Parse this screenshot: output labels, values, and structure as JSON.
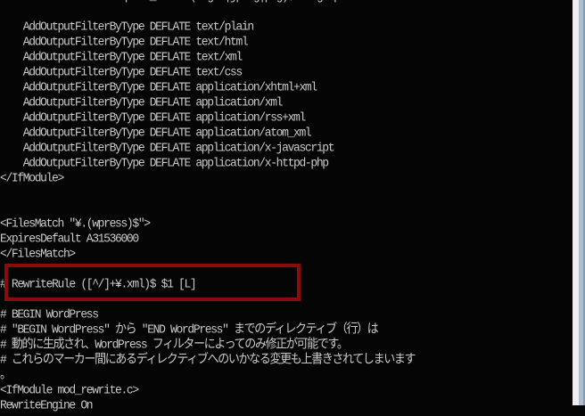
{
  "editor": {
    "lines": [
      "    SetEnvIfNoCase Request_URI ¥.(?:gif|jpe?g|png)$ no-gzip",
      "",
      "    AddOutputFilterByType DEFLATE text/plain",
      "    AddOutputFilterByType DEFLATE text/html",
      "    AddOutputFilterByType DEFLATE text/xml",
      "    AddOutputFilterByType DEFLATE text/css",
      "    AddOutputFilterByType DEFLATE application/xhtml+xml",
      "    AddOutputFilterByType DEFLATE application/xml",
      "    AddOutputFilterByType DEFLATE application/rss+xml",
      "    AddOutputFilterByType DEFLATE application/atom_xml",
      "    AddOutputFilterByType DEFLATE application/x-javascript",
      "    AddOutputFilterByType DEFLATE application/x-httpd-php",
      "</IfModule>",
      "",
      "",
      "<FilesMatch \"¥.(wpress)$\">",
      "ExpiresDefault A31536000",
      "</FilesMatch>",
      "",
      "# RewriteRule ([^/]+¥.xml)$ $1 [L]",
      "",
      "# BEGIN WordPress",
      "# \"BEGIN WordPress\" から \"END WordPress\" までのディレクティブ（行）は",
      "# 動的に生成され、WordPress フィルターによってのみ修正が可能です。",
      "# これらのマーカー間にあるディレクティブへのいかなる変更も上書きされてしまいます",
      "。",
      "<IfModule mod_rewrite.c>",
      "RewriteEngine On"
    ],
    "highlight_color": "#8b0a0a"
  }
}
